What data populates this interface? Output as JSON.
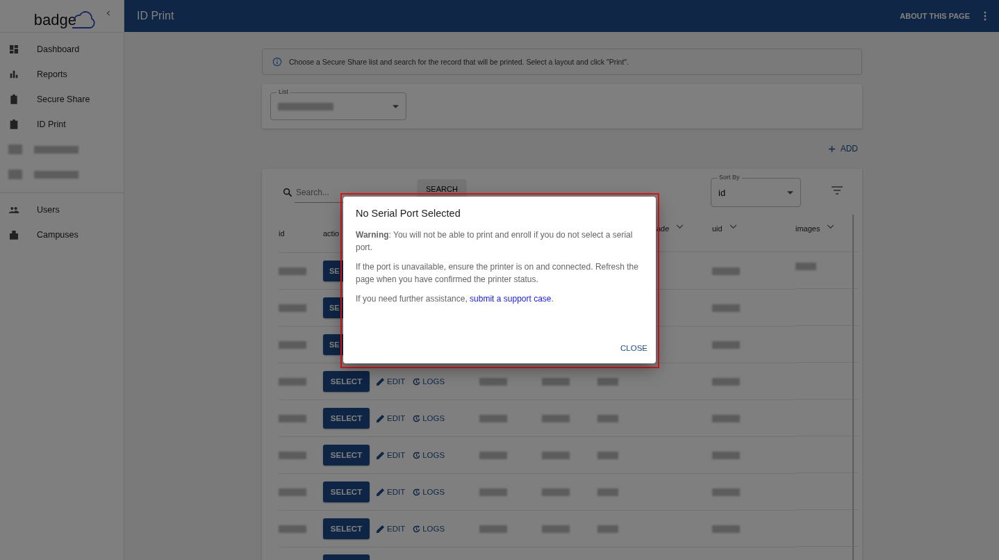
{
  "sidebar": {
    "logo": "badge",
    "groups": [
      {
        "items": [
          {
            "kind": "dashboard",
            "label": "Dashboard"
          },
          {
            "kind": "reports",
            "label": "Reports"
          },
          {
            "kind": "clipboard",
            "label": "Secure Share"
          },
          {
            "kind": "badge",
            "label": "ID Print"
          },
          {
            "kind": "redacted"
          },
          {
            "kind": "redacted"
          }
        ]
      },
      {
        "items": [
          {
            "kind": "users",
            "label": "Users"
          },
          {
            "kind": "building",
            "label": "Campuses"
          }
        ]
      }
    ]
  },
  "header": {
    "title": "ID Print",
    "about": "ABOUT THIS PAGE"
  },
  "info": "Choose a Secure Share list and search for the record that will be printed. Select a layout and click \"Print\".",
  "list_field": {
    "label": "List"
  },
  "add": "ADD",
  "search": {
    "placeholder": "Search...",
    "button": "SEARCH"
  },
  "sort": {
    "label": "Sort By",
    "value": "id"
  },
  "table": {
    "columns": [
      {
        "label": "id",
        "sort_menu": false
      },
      {
        "label": "actio",
        "sort_menu": false
      },
      {
        "label": "ade",
        "sort_menu": true
      },
      {
        "label": "uid",
        "sort_menu": true
      },
      {
        "label": "images",
        "sort_menu": true
      }
    ],
    "rows": [
      {
        "kind": "covered",
        "select": "SE"
      },
      {
        "kind": "covered",
        "select": "SE"
      },
      {
        "kind": "covered",
        "select": "SE"
      },
      {
        "kind": "full",
        "select": "SELECT",
        "edit": "EDIT",
        "logs": "LOGS"
      },
      {
        "kind": "full",
        "select": "SELECT",
        "edit": "EDIT",
        "logs": "LOGS"
      },
      {
        "kind": "full",
        "select": "SELECT",
        "edit": "EDIT",
        "logs": "LOGS"
      },
      {
        "kind": "full",
        "select": "SELECT",
        "edit": "EDIT",
        "logs": "LOGS"
      },
      {
        "kind": "full",
        "select": "SELECT",
        "edit": "EDIT",
        "logs": "LOGS"
      },
      {
        "kind": "cut"
      }
    ]
  },
  "dialog": {
    "highlighted": true,
    "title": "No Serial Port Selected",
    "paragraphs": [
      "**Warning**: You will not be able to print and enroll if you do not select a serial port.",
      "If the port is unavailable, ensure the printer is on and connected. Refresh the page when you have confirmed the printer status."
    ],
    "help": {
      "text": "If you need further assistance,",
      "link": "submit a support case",
      "after": "."
    },
    "close": "CLOSE"
  }
}
